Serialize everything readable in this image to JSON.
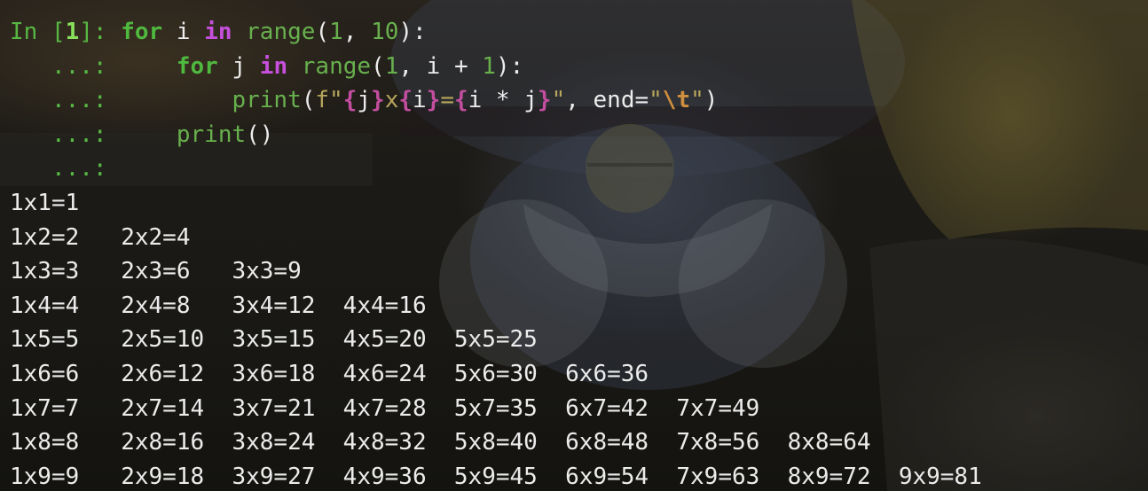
{
  "window": {
    "background_color": "#161511",
    "font_color": "#ececec"
  },
  "colors": {
    "prompt": "#58b843",
    "keyword": "#4fb83f",
    "in_keyword": "#c64fdc",
    "builtin": "#68b04e",
    "number": "#68b04e",
    "string": "#b7a65c",
    "fstring_brace": "#c34ea0",
    "escape": "#d08f3e",
    "operator": "#c04f93",
    "output": "#ececec"
  },
  "code_lines": [
    [
      {
        "text": "In [",
        "cls": "c-prompt"
      },
      {
        "text": "1",
        "cls": "c-promptnum"
      },
      {
        "text": "]: ",
        "cls": "c-prompt"
      },
      {
        "text": "for",
        "cls": "c-kw"
      },
      {
        "text": " i ",
        "cls": ""
      },
      {
        "text": "in",
        "cls": "c-in"
      },
      {
        "text": " ",
        "cls": ""
      },
      {
        "text": "range",
        "cls": "c-fn"
      },
      {
        "text": "(",
        "cls": ""
      },
      {
        "text": "1",
        "cls": "c-num"
      },
      {
        "text": ", ",
        "cls": ""
      },
      {
        "text": "10",
        "cls": "c-num"
      },
      {
        "text": "):",
        "cls": ""
      }
    ],
    [
      {
        "text": "   ...: ",
        "cls": "c-cont"
      },
      {
        "text": "    ",
        "cls": ""
      },
      {
        "text": "for",
        "cls": "c-kw"
      },
      {
        "text": " j ",
        "cls": ""
      },
      {
        "text": "in",
        "cls": "c-in"
      },
      {
        "text": " ",
        "cls": ""
      },
      {
        "text": "range",
        "cls": "c-fn"
      },
      {
        "text": "(",
        "cls": ""
      },
      {
        "text": "1",
        "cls": "c-num"
      },
      {
        "text": ", i + ",
        "cls": ""
      },
      {
        "text": "1",
        "cls": "c-num"
      },
      {
        "text": "):",
        "cls": ""
      }
    ],
    [
      {
        "text": "   ...: ",
        "cls": "c-cont"
      },
      {
        "text": "        ",
        "cls": ""
      },
      {
        "text": "print",
        "cls": "c-fn"
      },
      {
        "text": "(",
        "cls": ""
      },
      {
        "text": "f\"",
        "cls": "c-str"
      },
      {
        "text": "{",
        "cls": "c-brace"
      },
      {
        "text": "j",
        "cls": ""
      },
      {
        "text": "}",
        "cls": "c-brace"
      },
      {
        "text": "x",
        "cls": "c-str"
      },
      {
        "text": "{",
        "cls": "c-brace"
      },
      {
        "text": "i",
        "cls": ""
      },
      {
        "text": "}",
        "cls": "c-brace"
      },
      {
        "text": "=",
        "cls": "c-str"
      },
      {
        "text": "{",
        "cls": "c-brace"
      },
      {
        "text": "i * j",
        "cls": ""
      },
      {
        "text": "}",
        "cls": "c-brace"
      },
      {
        "text": "\"",
        "cls": "c-str"
      },
      {
        "text": ", end=",
        "cls": ""
      },
      {
        "text": "\"",
        "cls": "c-str"
      },
      {
        "text": "\\t",
        "cls": "c-esc"
      },
      {
        "text": "\"",
        "cls": "c-str"
      },
      {
        "text": ")",
        "cls": ""
      }
    ],
    [
      {
        "text": "   ...: ",
        "cls": "c-cont"
      },
      {
        "text": "    ",
        "cls": ""
      },
      {
        "text": "print",
        "cls": "c-fn"
      },
      {
        "text": "()",
        "cls": ""
      }
    ],
    [
      {
        "text": "   ...: ",
        "cls": "c-cont"
      }
    ]
  ],
  "output_lines": [
    "1x1=1\t",
    "1x2=2\t2x2=4\t",
    "1x3=3\t2x3=6\t3x3=9\t",
    "1x4=4\t2x4=8\t3x4=12\t4x4=16\t",
    "1x5=5\t2x5=10\t3x5=15\t4x5=20\t5x5=25\t",
    "1x6=6\t2x6=12\t3x6=18\t4x6=24\t5x6=30\t6x6=36\t",
    "1x7=7\t2x7=14\t3x7=21\t4x7=28\t5x7=35\t6x7=42\t7x7=49\t",
    "1x8=8\t2x8=16\t3x8=24\t4x8=32\t5x8=40\t6x8=48\t7x8=56\t8x8=64\t",
    "1x9=9\t2x9=18\t3x9=27\t4x9=36\t5x9=45\t6x9=54\t7x9=63\t8x9=72\t9x9=81\t"
  ]
}
